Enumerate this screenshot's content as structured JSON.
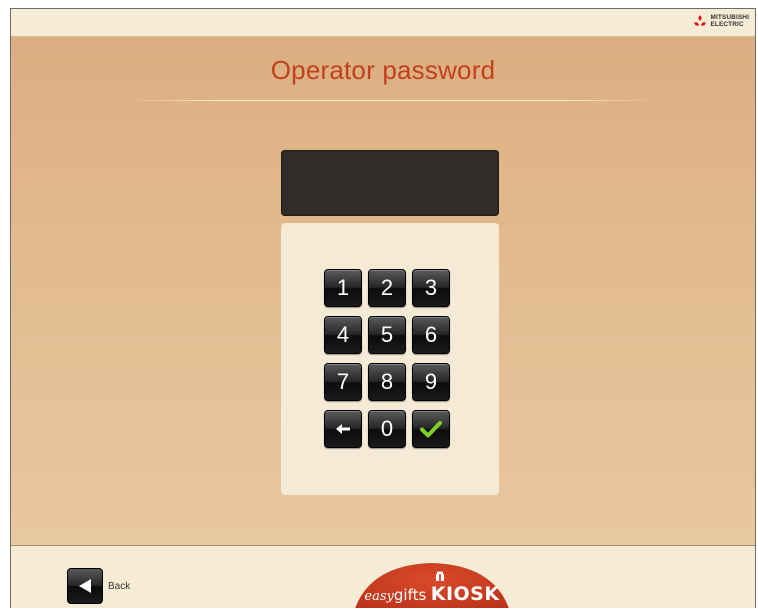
{
  "header": {
    "brand_text": "MITSUBISHI\nELECTRIC",
    "brand_icon": "mitsubishi-diamonds-icon"
  },
  "page": {
    "title": "Operator password"
  },
  "display": {
    "value": ""
  },
  "keypad": {
    "keys": [
      "1",
      "2",
      "3",
      "4",
      "5",
      "6",
      "7",
      "8",
      "9"
    ],
    "bottom_row": {
      "backspace_icon": "arrow-left-icon",
      "zero": "0",
      "confirm_icon": "check-icon"
    },
    "confirm_color": "#7fd12a"
  },
  "footer": {
    "back_label": "Back",
    "back_icon": "triangle-left-icon",
    "logo": {
      "easy": "easy",
      "gifts": "gifts",
      "kiosk": "KIOSK",
      "color": "#c0391d"
    }
  },
  "colors": {
    "title": "#c0421c",
    "background_top": "#dcae81",
    "panel": "#f4ead6"
  }
}
